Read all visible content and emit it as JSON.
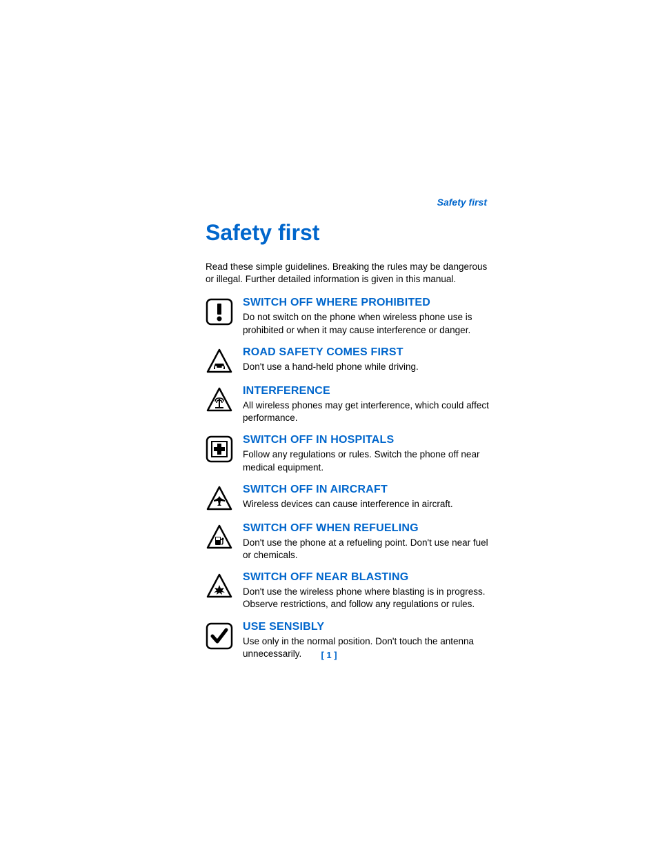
{
  "header_label": "Safety first",
  "page_title": "Safety first",
  "intro": "Read these simple guidelines. Breaking the rules may be dangerous or illegal. Further detailed information is given in this manual.",
  "items": [
    {
      "title": "SWITCH OFF WHERE PROHIBITED",
      "desc": "Do not switch on the phone when wireless phone use is prohibited or when it may cause interference or danger."
    },
    {
      "title": "ROAD SAFETY COMES FIRST",
      "desc": "Don't use a hand-held phone while driving."
    },
    {
      "title": "INTERFERENCE",
      "desc": "All wireless phones may get interference, which could affect performance."
    },
    {
      "title": "SWITCH OFF IN HOSPITALS",
      "desc": "Follow any regulations or rules. Switch the phone off near medical equipment."
    },
    {
      "title": "SWITCH OFF IN AIRCRAFT",
      "desc": "Wireless devices can cause interference in aircraft."
    },
    {
      "title": "SWITCH OFF WHEN REFUELING",
      "desc": "Don't use the phone at a refueling point. Don't use near fuel or chemicals."
    },
    {
      "title": "SWITCH OFF NEAR BLASTING",
      "desc": "Don't use the wireless phone where blasting is in progress. Observe restrictions, and follow any regulations or rules."
    },
    {
      "title": "USE SENSIBLY",
      "desc": "Use only in the normal position. Don't touch the antenna unnecessarily."
    }
  ],
  "page_number": "[ 1 ]"
}
